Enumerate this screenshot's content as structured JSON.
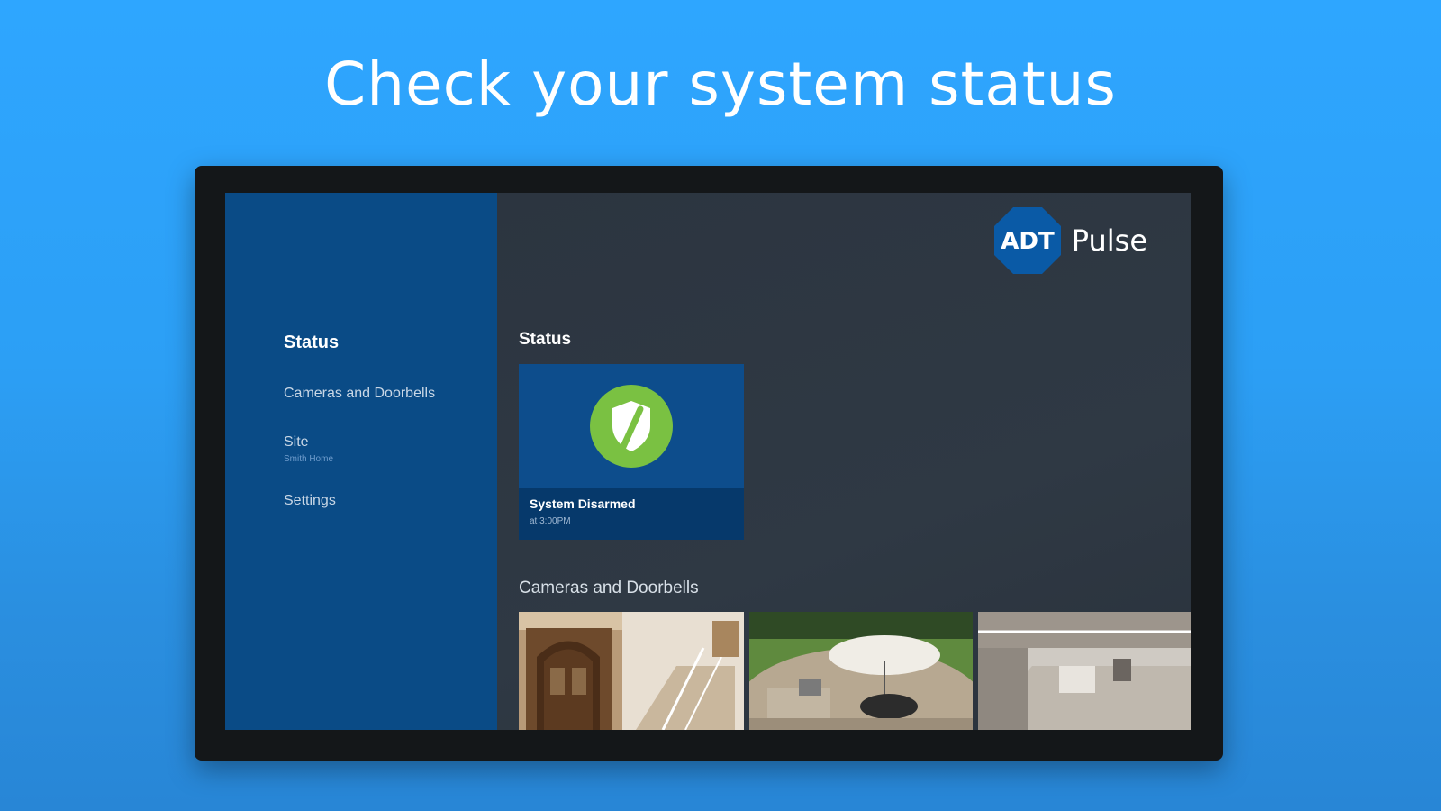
{
  "headline": "Check your system status",
  "logo": {
    "mark": "ADT",
    "word": "Pulse"
  },
  "sidebar": {
    "items": [
      {
        "label": "Status",
        "sub": ""
      },
      {
        "label": "Cameras and Doorbells",
        "sub": ""
      },
      {
        "label": "Site",
        "sub": "Smith Home"
      },
      {
        "label": "Settings",
        "sub": ""
      }
    ]
  },
  "main": {
    "status_section_title": "Status",
    "status_card": {
      "title": "System Disarmed",
      "subtitle": "at 3:00PM",
      "icon": "shield-check-icon"
    },
    "cameras_section_title": "Cameras and Doorbells",
    "cameras": [
      {
        "name": "entry-door-camera"
      },
      {
        "name": "backyard-patio-camera"
      },
      {
        "name": "garage-interior-camera"
      }
    ]
  },
  "colors": {
    "background": "#2ea6ff",
    "sidebar": "#0a4b86",
    "card": "#0d4d8c",
    "shield": "#7ac142"
  }
}
